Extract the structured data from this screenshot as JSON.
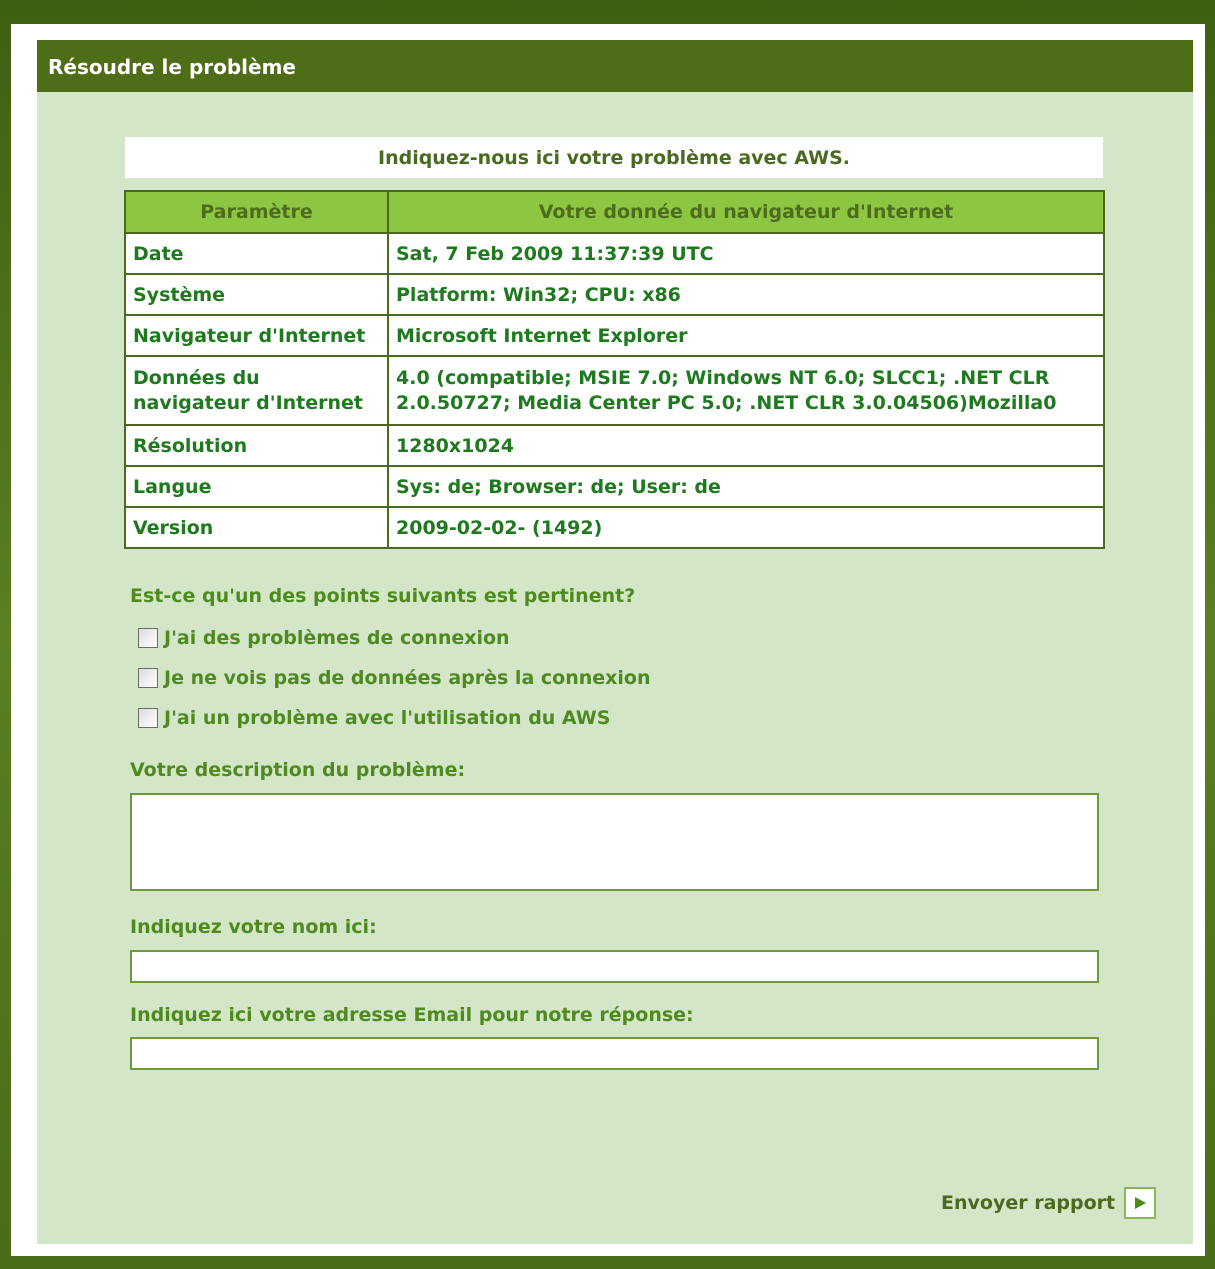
{
  "header": {
    "title": "Résoudre le problème"
  },
  "intro": {
    "text": "Indiquez-nous ici votre problème avec AWS."
  },
  "table": {
    "headers": [
      "Paramètre",
      "Votre donnée du navigateur d'Internet"
    ],
    "rows": [
      {
        "label": "Date",
        "value": "Sat, 7 Feb 2009 11:37:39 UTC"
      },
      {
        "label": "Système",
        "value": "Platform: Win32; CPU: x86"
      },
      {
        "label": "Navigateur d'Internet",
        "value": "Microsoft Internet Explorer"
      },
      {
        "label": "Données du navigateur d'Internet",
        "value": "4.0 (compatible; MSIE 7.0; Windows NT 6.0; SLCC1; .NET CLR 2.0.50727; Media Center PC 5.0; .NET CLR 3.0.04506)Mozilla0"
      },
      {
        "label": "Résolution",
        "value": "1280x1024"
      },
      {
        "label": "Langue",
        "value": "Sys: de; Browser: de; User: de"
      },
      {
        "label": "Version",
        "value": "2009-02-02- (1492)"
      }
    ]
  },
  "question": "Est-ce qu'un des points suivants est pertinent?",
  "options": [
    {
      "label": "J'ai des problèmes de connexion",
      "checked": false
    },
    {
      "label": "Je ne vois pas de données après la connexion",
      "checked": false
    },
    {
      "label": "J'ai un problème avec l'utilisation du AWS",
      "checked": false
    }
  ],
  "description": {
    "label": "Votre description du problème:",
    "value": ""
  },
  "name": {
    "label": "Indiquez votre nom ici:",
    "value": ""
  },
  "email": {
    "label": "Indiquez ici votre adresse Email pour notre réponse:",
    "value": ""
  },
  "send": {
    "label": "Envoyer rapport",
    "icon": "play-arrow-icon"
  },
  "colors": {
    "header_bg": "#4d6d16",
    "panel_bg": "#d3e7c8",
    "table_header_bg": "#8ec641",
    "label_text": "#4f8a1f",
    "value_text": "#1f7a1f"
  }
}
